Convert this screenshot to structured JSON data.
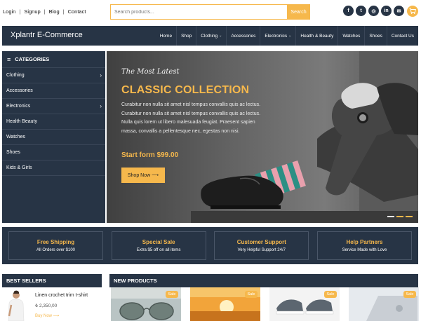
{
  "top_links": {
    "login": "Login",
    "signup": "Signup",
    "blog": "Blog",
    "contact": "Contact",
    "separator": "|"
  },
  "search": {
    "placeholder": "Search products...",
    "button_label": "Search"
  },
  "social_icons": [
    "facebook-icon",
    "twitter-icon",
    "instagram-icon",
    "linkedin-icon",
    "email-icon"
  ],
  "social_glyphs": [
    "f",
    "t",
    "◎",
    "in",
    "✉"
  ],
  "cart_icon": "cart-icon",
  "brand": "Xplantr E-Commerce",
  "nav": [
    {
      "label": "Home",
      "caret": ""
    },
    {
      "label": "Shop",
      "caret": ""
    },
    {
      "label": "Clothing",
      "caret": "⌄"
    },
    {
      "label": "Accessories",
      "caret": ""
    },
    {
      "label": "Electronics",
      "caret": "⌄"
    },
    {
      "label": "Health & Beauty",
      "caret": ""
    },
    {
      "label": "Watches",
      "caret": ""
    },
    {
      "label": "Shoes",
      "caret": ""
    },
    {
      "label": "Contact Us",
      "caret": ""
    }
  ],
  "categories": {
    "title": "CATEGORIES",
    "items": [
      {
        "label": "Clothing",
        "arrow": "›"
      },
      {
        "label": "Accessories",
        "arrow": ""
      },
      {
        "label": "Electronics",
        "arrow": "›"
      },
      {
        "label": "Health Beauty",
        "arrow": ""
      },
      {
        "label": "Watches",
        "arrow": ""
      },
      {
        "label": "Shoes",
        "arrow": ""
      },
      {
        "label": "Kids & Girls",
        "arrow": ""
      }
    ]
  },
  "hero": {
    "subtitle": "The Most Latest",
    "title": "CLASSIC COLLECTION",
    "text": "Curabitur non nulla sit amet nisl tempus convallis quis ac lectus. Curabitur non nulla sit amet nisl tempus convallis quis ac lectus. Nulla quis lorem ut libero malesuada feugiat. Praesent sapien massa, convallis a pellentesque nec, egestas non nisi.",
    "price": "Start form $99.00",
    "button_label": "Shop Now ⟶",
    "active_slide": 1,
    "slide_count": 3
  },
  "features": [
    {
      "title": "Free Shipping",
      "subtitle": "All Orders over $100"
    },
    {
      "title": "Special Sale",
      "subtitle": "Extra $5 off on all items"
    },
    {
      "title": "Customer Support",
      "subtitle": "Very Helpful Support 24/7"
    },
    {
      "title": "Help Partners",
      "subtitle": "Service Made with Love"
    }
  ],
  "best_sellers": {
    "title": "BEST SELLERS",
    "items": [
      {
        "name": "Linen crochet trim t-shirt",
        "price": "₺ 2,350,00",
        "cta": "Buy Now ⟶"
      }
    ]
  },
  "new_products": {
    "title": "NEW PRODUCTS",
    "items": [
      {
        "badge": "Sale",
        "image": "sunglasses"
      },
      {
        "badge": "Sale",
        "image": "sunset"
      },
      {
        "badge": "Sale",
        "image": "sneakers"
      },
      {
        "badge": "Sale",
        "image": "laptop"
      }
    ]
  },
  "colors": {
    "navy": "#273445",
    "accent": "#f6b84c"
  }
}
